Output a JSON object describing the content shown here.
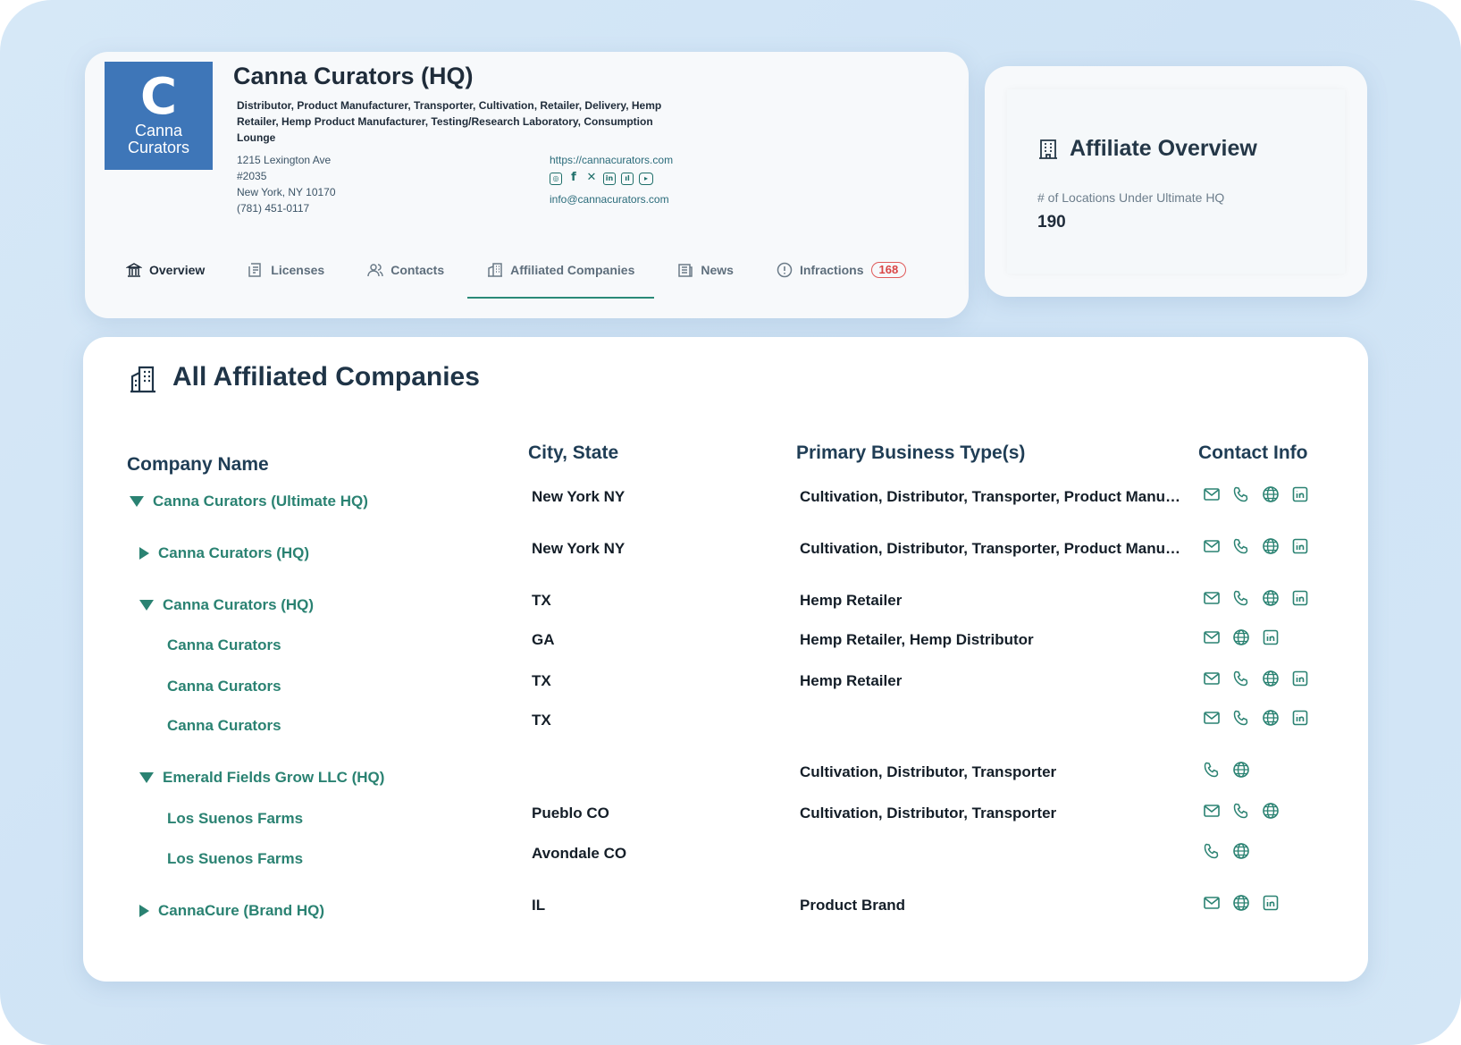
{
  "header": {
    "logo_glyph": "C",
    "logo_line1": "Canna",
    "logo_line2": "Curators",
    "title": "Canna Curators (HQ)",
    "types": "Distributor, Product Manufacturer, Transporter, Cultivation, Retailer, Delivery, Hemp Retailer, Hemp Product Manufacturer, Testing/Research Laboratory, Consumption Lounge",
    "address": [
      "1215 Lexington Ave",
      "#2035",
      "New York, NY 10170",
      "(781) 451-0117"
    ],
    "website": "https://cannacurators.com",
    "email": "info@cannacurators.com",
    "social": [
      "instagram-icon",
      "facebook-icon",
      "x-icon",
      "linkedin-icon",
      "social-icon",
      "youtube-icon"
    ]
  },
  "tabs": [
    {
      "label": "Overview",
      "icon": "bank-icon"
    },
    {
      "label": "Licenses",
      "icon": "license-icon"
    },
    {
      "label": "Contacts",
      "icon": "contacts-icon"
    },
    {
      "label": "Affiliated Companies",
      "icon": "building-icon"
    },
    {
      "label": "News",
      "icon": "news-icon"
    },
    {
      "label": "Infractions",
      "icon": "alert-icon",
      "badge": "168"
    }
  ],
  "overview": {
    "title": "Affiliate Overview",
    "label": "# of Locations Under Ultimate HQ",
    "value": "190"
  },
  "table": {
    "title": "All Affiliated Companies",
    "columns": [
      "Company Name",
      "City, State",
      "Primary Business Type(s)",
      "Contact Info"
    ],
    "rows": [
      {
        "name": "Canna Curators (Ultimate HQ)",
        "toggle": "down",
        "city": "New York NY",
        "type": "Cultivation, Distributor, Transporter, Product Manufacturer",
        "contacts": [
          "mail",
          "phone",
          "globe",
          "linkedin"
        ]
      },
      {
        "name": "Canna Curators (HQ)",
        "toggle": "right",
        "city": "New York NY",
        "type": "Cultivation, Distributor, Transporter, Product Manufacturer",
        "contacts": [
          "mail",
          "phone",
          "globe",
          "linkedin"
        ]
      },
      {
        "name": "Canna Curators (HQ)",
        "toggle": "down",
        "city": "TX",
        "type": "Hemp Retailer",
        "contacts": [
          "mail",
          "phone",
          "globe",
          "linkedin"
        ]
      },
      {
        "name": "Canna Curators",
        "toggle": "",
        "city": "GA",
        "type": "Hemp Retailer, Hemp Distributor",
        "contacts": [
          "mail",
          "globe",
          "linkedin"
        ]
      },
      {
        "name": "Canna Curators",
        "toggle": "",
        "city": "TX",
        "type": "Hemp Retailer",
        "contacts": [
          "mail",
          "phone",
          "globe",
          "linkedin"
        ]
      },
      {
        "name": "Canna Curators",
        "toggle": "",
        "city": "TX",
        "type": "",
        "contacts": [
          "mail",
          "phone",
          "globe",
          "linkedin"
        ]
      },
      {
        "name": "Emerald Fields Grow LLC (HQ)",
        "toggle": "down",
        "city": "",
        "type": "Cultivation, Distributor, Transporter",
        "contacts": [
          "phone",
          "globe"
        ]
      },
      {
        "name": "Los Suenos Farms",
        "toggle": "",
        "city": "Pueblo CO",
        "type": "Cultivation, Distributor, Transporter",
        "contacts": [
          "mail",
          "phone",
          "globe"
        ]
      },
      {
        "name": "Los Suenos Farms",
        "toggle": "",
        "city": "Avondale CO",
        "type": "",
        "contacts": [
          "phone",
          "globe"
        ]
      },
      {
        "name": "CannaCure (Brand HQ)",
        "toggle": "right",
        "city": "IL",
        "type": "Product Brand",
        "contacts": [
          "mail",
          "globe",
          "linkedin"
        ]
      }
    ]
  },
  "colors": {
    "accent": "#2a8272",
    "logo": "#3e76b8",
    "badge": "#d94545"
  }
}
